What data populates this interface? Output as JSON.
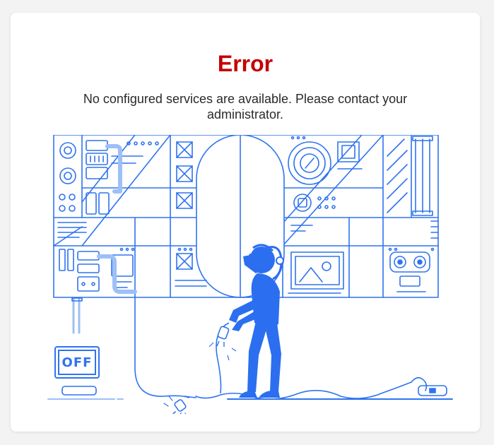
{
  "error": {
    "title": "Error",
    "message": "No configured services are available. Please contact your administrator."
  },
  "illustration": {
    "switch_label": "OFF"
  },
  "colors": {
    "title": "#c40000",
    "line": "#2f73f0",
    "figure": "#2b6ff0",
    "light_line": "#9cc0f7",
    "background": "#f3f3f3",
    "card": "#ffffff"
  }
}
